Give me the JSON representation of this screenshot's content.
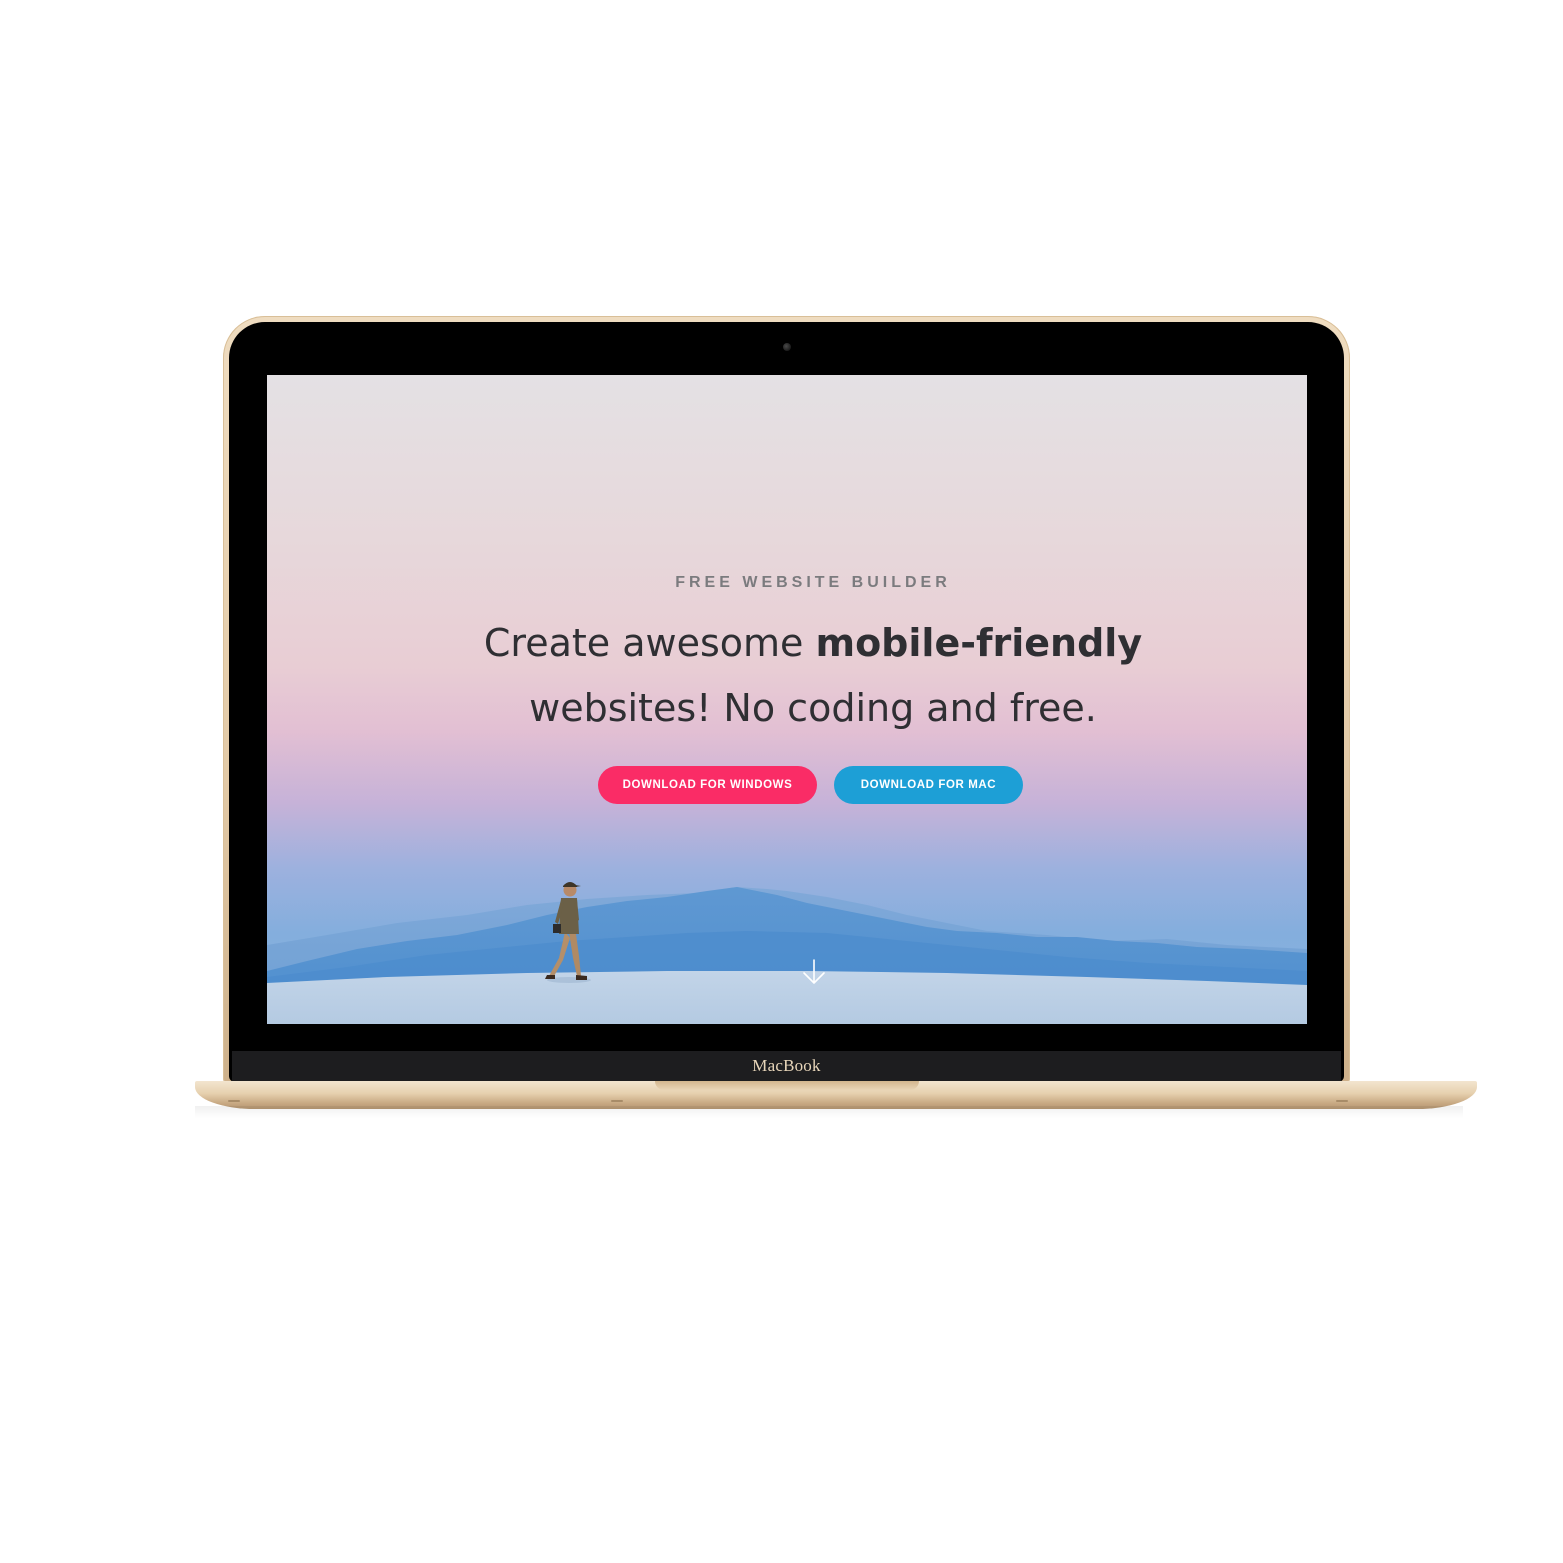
{
  "device": {
    "brand_label": "MacBook"
  },
  "hero": {
    "eyebrow": "FREE WEBSITE BUILDER",
    "headline_part1": "Create awesome ",
    "headline_bold": "mobile-friendly",
    "headline_part2": "websites! No coding and free.",
    "buttons": {
      "windows_label": "DOWNLOAD FOR WINDOWS",
      "mac_label": "DOWNLOAD FOR MAC"
    },
    "scroll_icon": "arrow-down-icon"
  },
  "colors": {
    "windows_button": "#fa2c66",
    "mac_button": "#1d9fd6",
    "headline_text": "#2f2f33",
    "eyebrow_text": "#7b7b7e",
    "laptop_gold": "#e2c9a6"
  }
}
